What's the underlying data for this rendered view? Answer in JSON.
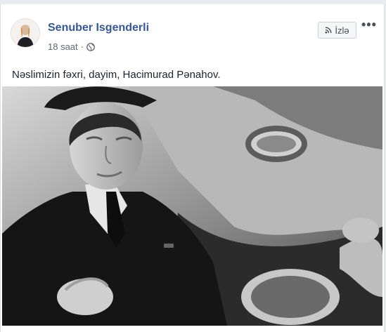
{
  "post": {
    "author_name": "Senuber Isgenderli",
    "timestamp": "18 saat",
    "separator": "·",
    "privacy_icon": "globe-icon",
    "follow_label": "İzlə",
    "follow_icon": "rss-icon",
    "more_label": "•••",
    "text": "Nəslimizin fəxri, dayim, Hacimurad Pənahov.",
    "link_colour": "#365899"
  }
}
